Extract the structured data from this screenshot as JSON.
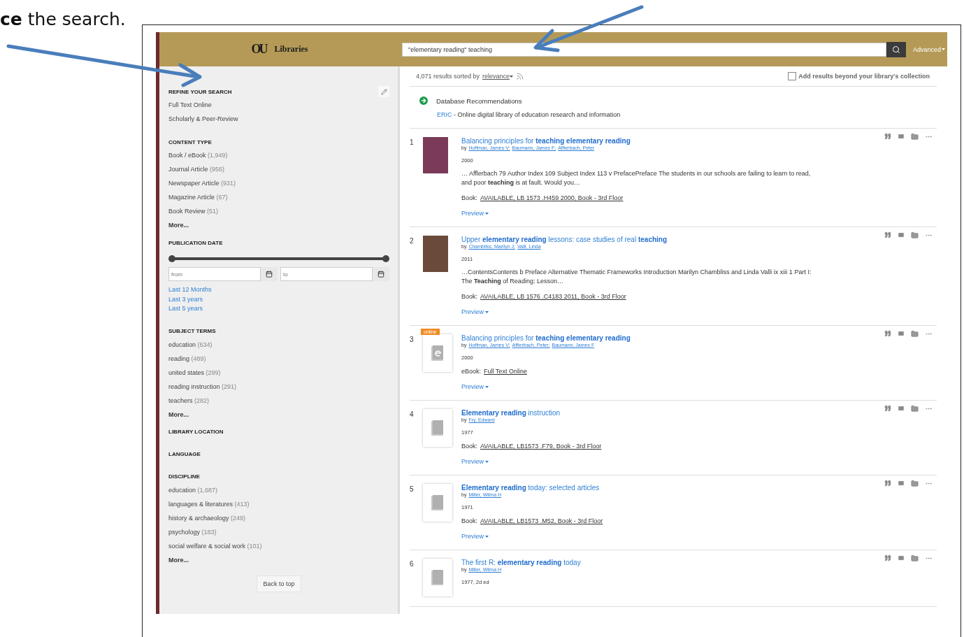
{
  "document_text": "**ce** the search.",
  "header": {
    "logo_mark": "OU",
    "logo_text": "Libraries",
    "search_value": "\"elementary reading\" teaching",
    "advanced": "Advanced"
  },
  "sidebar": {
    "sections": [
      {
        "kind": "refine",
        "title": "REFINE YOUR SEARCH",
        "items": [
          {
            "label": "Full Text Online"
          },
          {
            "label": "Scholarly & Peer-Review"
          }
        ]
      },
      {
        "kind": "facet",
        "title": "CONTENT TYPE",
        "items": [
          {
            "label": "Book / eBook",
            "count": "(1,949)"
          },
          {
            "label": "Journal Article",
            "count": "(956)"
          },
          {
            "label": "Newspaper Article",
            "count": "(931)"
          },
          {
            "label": "Magazine Article",
            "count": "(67)"
          },
          {
            "label": "Book Review",
            "count": "(51)"
          }
        ],
        "more": "More..."
      },
      {
        "kind": "date",
        "title": "PUBLICATION DATE",
        "level": 1,
        "from_placeholder": "from",
        "to_placeholder": "to",
        "links": [
          "Last 12 Months",
          "Last 3 years",
          "Last 5 years"
        ]
      },
      {
        "kind": "facet",
        "title": "SUBJECT TERMS",
        "items": [
          {
            "label": "education",
            "count": "(634)"
          },
          {
            "label": "reading",
            "count": "(489)"
          },
          {
            "label": "united states",
            "count": "(299)"
          },
          {
            "label": "reading instruction",
            "count": "(291)"
          },
          {
            "label": "teachers",
            "count": "(282)"
          }
        ],
        "more": "More..."
      },
      {
        "kind": "facet",
        "title": "LIBRARY LOCATION"
      },
      {
        "kind": "facet",
        "title": "LANGUAGE"
      },
      {
        "kind": "facet",
        "title": "DISCIPLINE",
        "items": [
          {
            "label": "education",
            "count": "(1,687)"
          },
          {
            "label": "languages & literatures",
            "count": "(413)"
          },
          {
            "label": "history & archaeology",
            "count": "(249)"
          },
          {
            "label": "psychology",
            "count": "(183)"
          },
          {
            "label": "social welfare & social work",
            "count": "(101)"
          }
        ],
        "more": "More..."
      }
    ],
    "back_to_top": "Back to top"
  },
  "main": {
    "results_count": "4,071 results sorted by",
    "sort": "relevance",
    "add_beyond": {
      "label": "Add results beyond your library's collection",
      "checked": false
    },
    "recommendations": {
      "title": "Database Recommendations",
      "link": "ERIC",
      "description": "- Online digital library of education research and information"
    },
    "results": [
      {
        "number": "1",
        "kind": "photo",
        "title": "Balancing principles for **teaching elementary reading**",
        "by": "by",
        "authors": [
          "Hoffman, James V;",
          "Baumann, James F;",
          "Afflerbach, Peter"
        ],
        "year": "2000",
        "snippet": "… Afflerbach 79 Author Index 109 Subject Index 113 v PrefacePreface The students in our schools are failing to learn to read, and poor **teaching** is at fault. Would you…",
        "format": "Book:",
        "availability": "AVAILABLE, LB 1573 .H459 2000, Book - 3rd Floor",
        "preview": "Preview"
      },
      {
        "number": "2",
        "kind": "photo",
        "title": "Upper **elementary reading** lessons: case studies of real **teaching**",
        "by": "by",
        "authors": [
          "Chambliss, Marilyn J;",
          "Valli, Linda"
        ],
        "year": "2011",
        "snippet": "…ContentsContents b Preface Alternative Thematic Frameworks Introduction Marilyn Chambliss and Linda Valli ix xiii 1 Part I: The **Teaching** of Reading: Lesson…",
        "format": "Book:",
        "availability": "AVAILABLE, LB 1576 .C4183 2011, Book - 3rd Floor",
        "preview": "Preview"
      },
      {
        "number": "3",
        "kind": "ebook",
        "badge": "online",
        "title": "Balancing principles for **teaching elementary reading**",
        "by": "by",
        "authors": [
          "Hoffman, James V;",
          "Afflerbach, Peter;",
          "Baumann, James F"
        ],
        "year": "2000",
        "format": "eBook:",
        "availability": "Full Text Online",
        "preview": "Preview"
      },
      {
        "number": "4",
        "kind": "book",
        "title": "**Elementary reading** instruction",
        "by": "by",
        "authors": [
          "Fry, Edward"
        ],
        "year": "1977",
        "format": "Book:",
        "availability": "AVAILABLE, LB1573 .F79, Book - 3rd Floor",
        "preview": "Preview"
      },
      {
        "number": "5",
        "kind": "book",
        "title": "**Elementary reading** today: selected articles",
        "by": "by",
        "authors": [
          "Miller, Wilma H"
        ],
        "year": "1971",
        "format": "Book:",
        "availability": "AVAILABLE, LB1573 .M52, Book - 3rd Floor",
        "preview": "Preview"
      },
      {
        "number": "6",
        "kind": "book",
        "title": "The first R: **elementary reading** today",
        "by": "by",
        "authors": [
          "Miller, Wilma H"
        ],
        "year": "1977, 2d ed"
      }
    ]
  }
}
